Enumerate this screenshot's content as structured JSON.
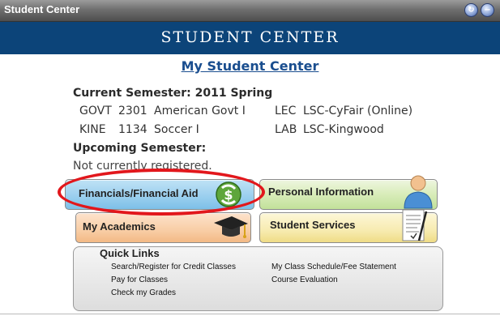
{
  "window": {
    "title": "Student Center",
    "refresh_icon": "refresh-icon",
    "collapse_icon": "collapse-icon",
    "refresh_glyph": "↻",
    "collapse_glyph": "−"
  },
  "banner": {
    "title": "STUDENT CENTER"
  },
  "my_student_center_link": "My Student Center",
  "current_semester": {
    "label": "Current Semester: 2011 Spring",
    "courses": [
      {
        "subject": "GOVT",
        "number": "2301",
        "title": "American Govt I",
        "type": "LEC",
        "campus": "LSC-CyFair (Online)"
      },
      {
        "subject": "KINE",
        "number": "1134",
        "title": "Soccer I",
        "type": "LAB",
        "campus": "LSC-Kingwood"
      }
    ]
  },
  "upcoming_semester": {
    "label": "Upcoming Semester:",
    "status": "Not currently registered."
  },
  "tiles": {
    "financials": "Financials/Financial Aid",
    "personal": "Personal Information",
    "academics": "My Academics",
    "services": "Student Services"
  },
  "quick_links": {
    "heading": "Quick Links",
    "left": [
      "Search/Register for Credit Classes",
      "Pay for Classes",
      "Check my Grades"
    ],
    "right": [
      "My Class Schedule/Fee Statement",
      "Course Evaluation"
    ]
  },
  "colors": {
    "banner": "#0c4479",
    "highlight": "#e2171c",
    "link": "#1a4e8f"
  }
}
